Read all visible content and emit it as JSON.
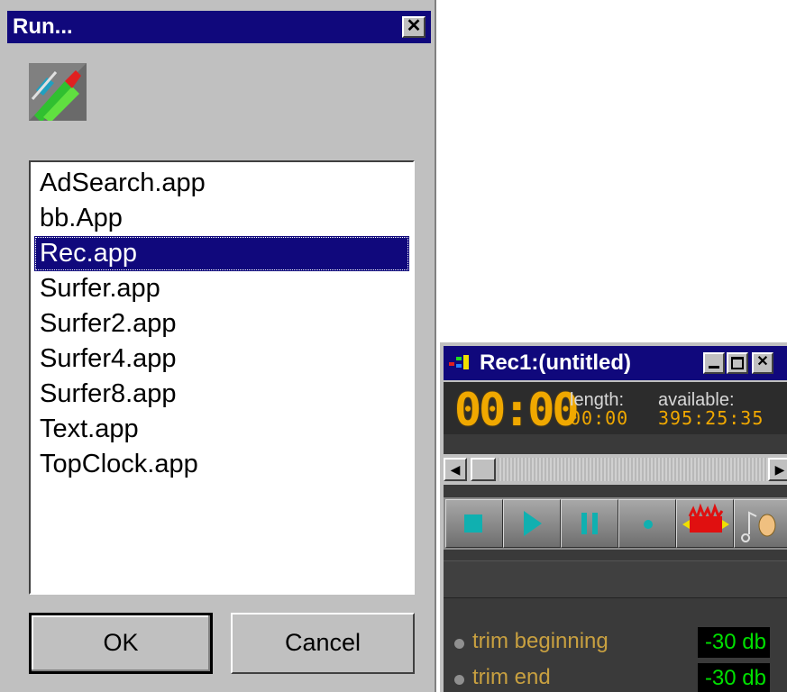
{
  "run_dialog": {
    "title": "Run...",
    "close_glyph": "✕",
    "items": [
      "AdSearch.app",
      "bb.App",
      "Rec.app",
      "Surfer.app",
      "Surfer2.app",
      "Surfer4.app",
      "Surfer8.app",
      "Text.app",
      "TopClock.app"
    ],
    "selected_item": "Rec.app",
    "ok_label": "OK",
    "cancel_label": "Cancel"
  },
  "rec_window": {
    "title": "Rec1:(untitled)",
    "time": "00:00",
    "length_label": "length:",
    "length_value": "00:00",
    "available_label": "available:",
    "available_value": "395:25:35",
    "transport": [
      "stop",
      "play",
      "pause",
      "record",
      "waveform",
      "music-ear"
    ],
    "trim_beginning_label": "trim beginning",
    "trim_beginning_value": "-30 db",
    "trim_end_label": "trim end",
    "trim_end_value": "-30 db"
  },
  "colors": {
    "titlebar": "#10087c",
    "lcd_amber": "#f0a800",
    "db_green": "#00e000",
    "trim_label": "#c8a040"
  }
}
